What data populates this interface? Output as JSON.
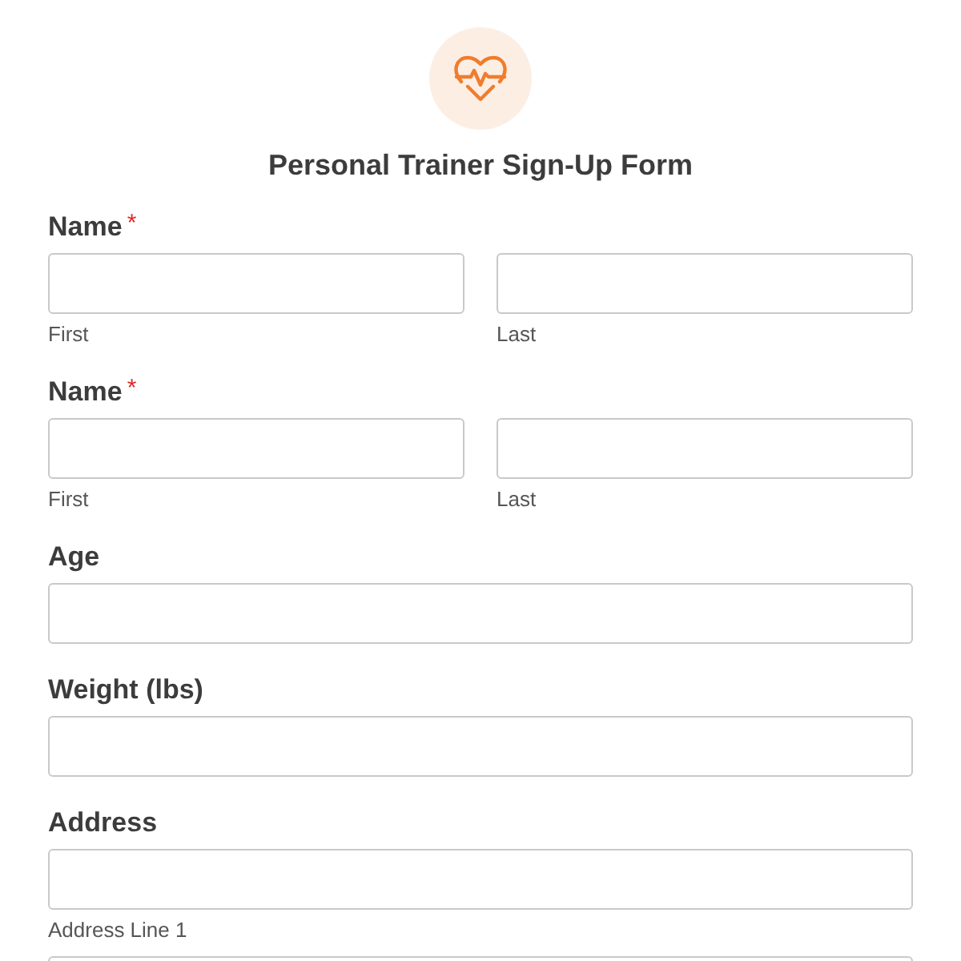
{
  "form": {
    "title": "Personal Trainer Sign-Up Form"
  },
  "fields": [
    {
      "kind": "name",
      "label": "Name",
      "required_mark": "*",
      "sublabels": [
        "First",
        "Last"
      ]
    },
    {
      "kind": "name",
      "label": "Name",
      "required_mark": "*",
      "sublabels": [
        "First",
        "Last"
      ]
    },
    {
      "kind": "single",
      "label": "Age"
    },
    {
      "kind": "single",
      "label": "Weight (lbs)"
    },
    {
      "kind": "address",
      "label": "Address",
      "sublabels": [
        "Address Line 1"
      ]
    }
  ]
}
